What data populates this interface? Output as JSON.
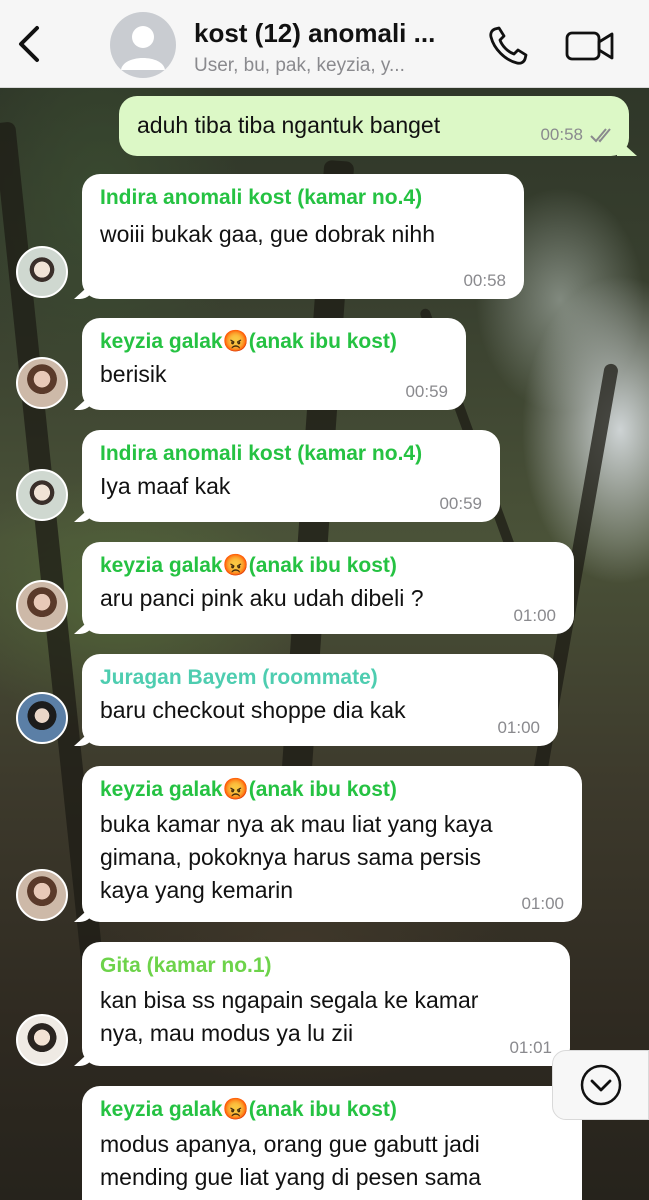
{
  "header": {
    "title": "kost (12) anomali ...",
    "subtitle": "User, bu, pak, keyzia, y..."
  },
  "icons": {
    "back": "chevron-left-icon",
    "group_avatar": "person-silhouette-icon",
    "call": "phone-icon",
    "video": "video-camera-icon",
    "scroll_down": "chevron-down-circle-icon",
    "read_receipt": "double-check-icon"
  },
  "colors": {
    "outgoing_bubble": "#dcf8c6",
    "incoming_bubble": "#ffffff",
    "sender_green": "#25c242",
    "sender_teal": "#4ecdb0",
    "sender_lime": "#6dd34a"
  },
  "messages": [
    {
      "direction": "out",
      "lines": [
        "aduh tiba tiba ngantuk banget"
      ],
      "time": "00:58",
      "status": "read"
    },
    {
      "direction": "in",
      "sender": "Indira anomali kost (kamar no.4)",
      "lines": [
        "woiii bukak gaa, gue dobrak nihh"
      ],
      "time": "00:58"
    },
    {
      "direction": "in",
      "sender": "keyzia galak😡(anak ibu kost)",
      "lines": [
        "berisik"
      ],
      "time": "00:59"
    },
    {
      "direction": "in",
      "sender": "Indira anomali kost (kamar no.4)",
      "lines": [
        "Iya maaf kak"
      ],
      "time": "00:59"
    },
    {
      "direction": "in",
      "sender": "keyzia galak😡(anak ibu kost)",
      "lines": [
        "aru panci pink aku udah dibeli ?"
      ],
      "time": "01:00"
    },
    {
      "direction": "in",
      "sender": "Juragan Bayem (roommate)",
      "lines": [
        "baru checkout shoppe dia kak"
      ],
      "time": "01:00"
    },
    {
      "direction": "in",
      "sender": "keyzia galak😡(anak ibu kost)",
      "lines": [
        "buka kamar nya ak mau liat yang kaya",
        "gimana, pokoknya harus sama persis",
        "kaya yang kemarin"
      ],
      "time": "01:00"
    },
    {
      "direction": "in",
      "sender": "Gita (kamar no.1)",
      "lines": [
        "kan bisa ss ngapain segala ke kamar",
        "nya, mau modus ya lu zii"
      ],
      "time": "01:01"
    },
    {
      "direction": "in",
      "sender": "keyzia galak😡(anak ibu kost)",
      "lines": [
        "modus apanya, orang gue gabutt jadi",
        "mending gue liat yang di pesen sama"
      ],
      "time": ""
    }
  ]
}
